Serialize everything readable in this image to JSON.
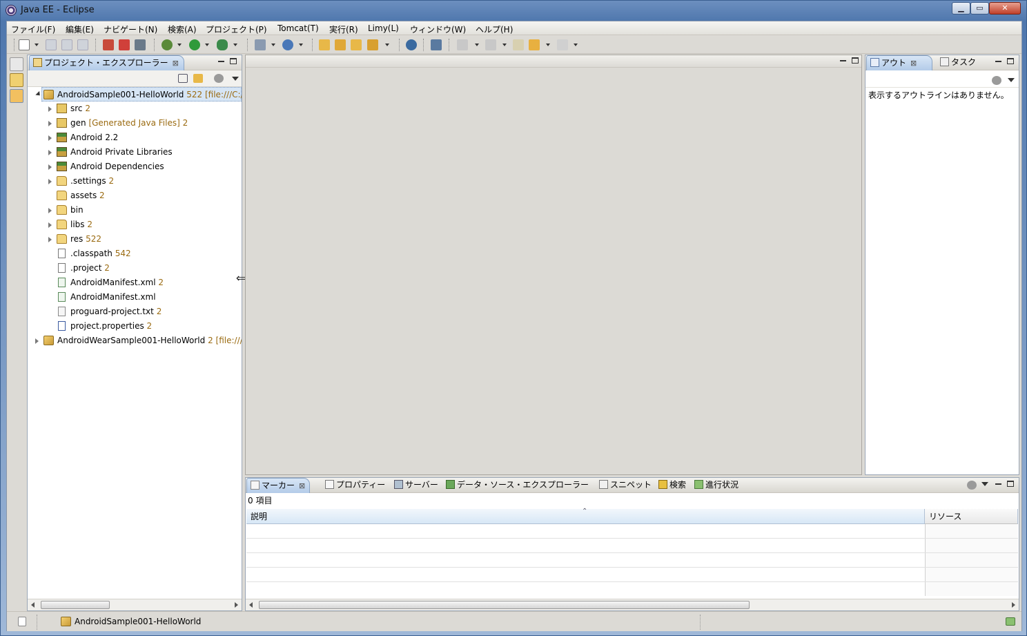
{
  "window": {
    "title": "Java EE - Eclipse",
    "min": "▁",
    "max": "▭",
    "close": "✕"
  },
  "menu": [
    {
      "label": "ファイル(F)"
    },
    {
      "label": "編集(E)"
    },
    {
      "label": "ナビゲート(N)"
    },
    {
      "label": "検索(A)"
    },
    {
      "label": "プロジェクト(P)"
    },
    {
      "label": "Tomcat(T)"
    },
    {
      "label": "実行(R)"
    },
    {
      "label": "Limy(L)"
    },
    {
      "label": "ウィンドウ(W)"
    },
    {
      "label": "ヘルプ(H)"
    }
  ],
  "project_explorer": {
    "tab_label": "プロジェクト・エクスプローラー",
    "tree": [
      {
        "label": "AndroidSample001-HelloWorld",
        "decor": "522 [file:///C:/"
      },
      {
        "label": "src",
        "decor": "2"
      },
      {
        "label": "gen",
        "decor": "[Generated Java Files] 2"
      },
      {
        "label": "Android 2.2",
        "decor": ""
      },
      {
        "label": "Android Private Libraries",
        "decor": ""
      },
      {
        "label": "Android Dependencies",
        "decor": ""
      },
      {
        "label": ".settings",
        "decor": "2"
      },
      {
        "label": "assets",
        "decor": "2"
      },
      {
        "label": "bin",
        "decor": ""
      },
      {
        "label": "libs",
        "decor": "2"
      },
      {
        "label": "res",
        "decor": "522"
      },
      {
        "label": ".classpath",
        "decor": "542"
      },
      {
        "label": ".project",
        "decor": "2"
      },
      {
        "label": "AndroidManifest.xml",
        "decor": "2"
      },
      {
        "label": "AndroidManifest.xml",
        "decor": ""
      },
      {
        "label": "proguard-project.txt",
        "decor": "2"
      },
      {
        "label": "project.properties",
        "decor": "2"
      },
      {
        "label": "AndroidWearSample001-HelloWorld",
        "decor": "2 [file:///"
      }
    ]
  },
  "outline": {
    "tabs": [
      {
        "label": "アウト"
      },
      {
        "label": "タスク"
      }
    ],
    "empty_message": "表示するアウトラインはありません。"
  },
  "bottom": {
    "tabs": [
      {
        "label": "マーカー"
      },
      {
        "label": "プロパティー"
      },
      {
        "label": "サーバー"
      },
      {
        "label": "データ・ソース・エクスプローラー"
      },
      {
        "label": "スニペット"
      },
      {
        "label": "検索"
      },
      {
        "label": "進行状況"
      }
    ],
    "item_count": "0 項目",
    "columns": [
      {
        "label": "説明"
      },
      {
        "label": "リソース"
      }
    ]
  },
  "status": {
    "selected": "AndroidSample001-HelloWorld"
  }
}
